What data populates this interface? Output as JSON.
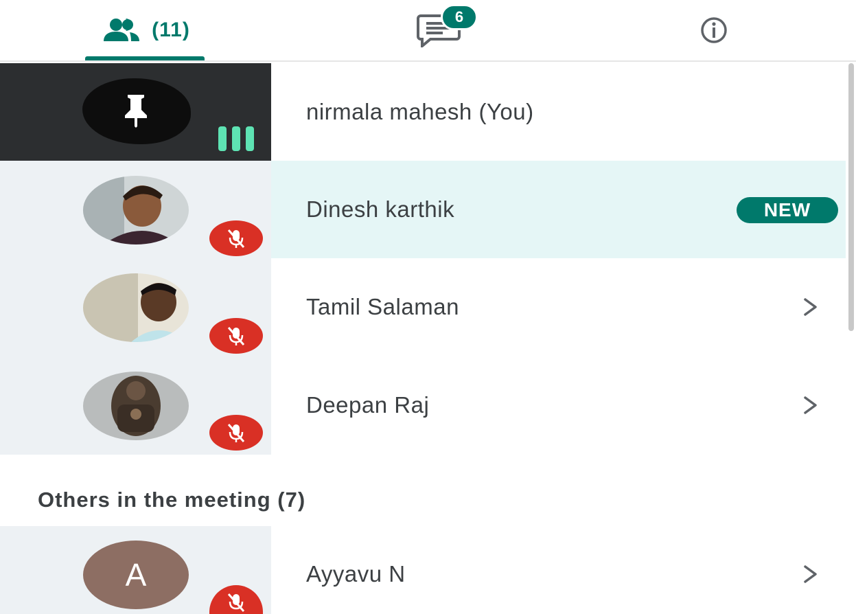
{
  "tabs": {
    "people": {
      "icon": "people-icon",
      "count_label": "(11)"
    },
    "chat": {
      "icon": "chat-icon",
      "badge": "6"
    },
    "info": {
      "icon": "info-icon"
    }
  },
  "participants": [
    {
      "name": "nirmala mahesh (You)",
      "icon": "pin-icon",
      "status": "speaking-indicator"
    },
    {
      "name": "Dinesh karthik",
      "badge": "NEW",
      "status": "mic-off-icon"
    },
    {
      "name": "Tamil Salaman",
      "status": "mic-off-icon"
    },
    {
      "name": "Deepan Raj",
      "status": "mic-off-icon"
    }
  ],
  "others_section": {
    "title": "Others in the meeting (7)",
    "items": [
      {
        "name": "Ayyavu N",
        "initial": "A",
        "status": "mic-off-icon"
      }
    ]
  },
  "colors": {
    "accent": "#00796b",
    "mute": "#d93025",
    "highlight": "#e5f6f6",
    "tile": "#edf1f4",
    "speaking": "#5ee3b3"
  }
}
